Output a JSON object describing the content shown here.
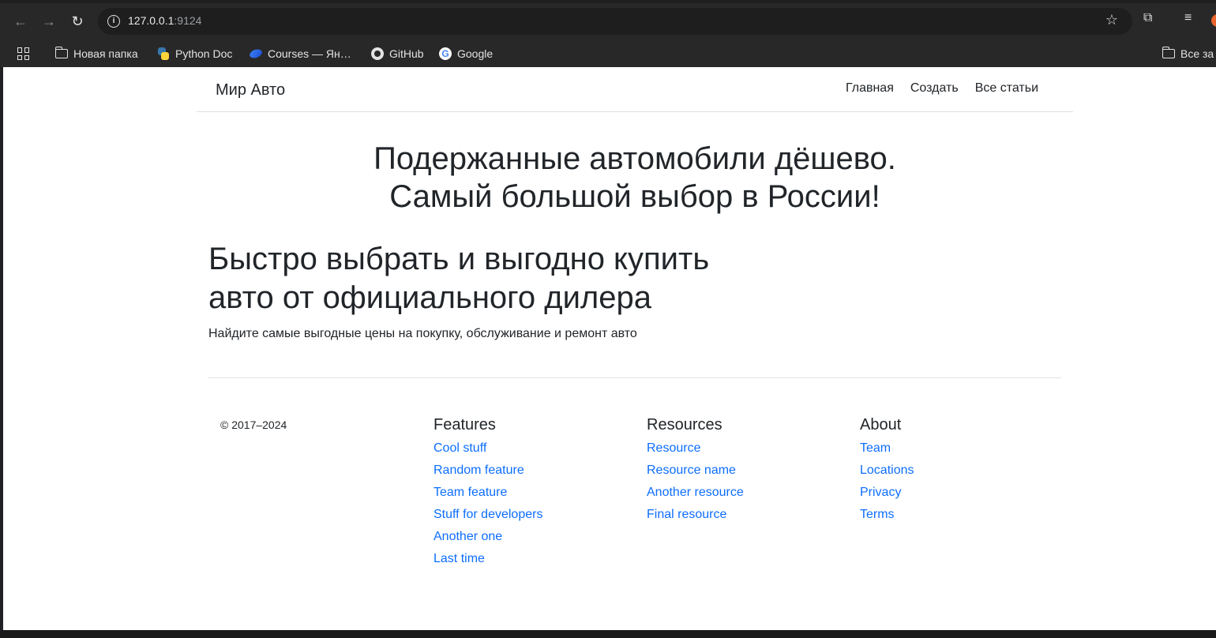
{
  "browser": {
    "url_host": "127.0.0.1",
    "url_port": ":9124",
    "back_icon": "arrow-left-icon",
    "forward_icon": "arrow-right-icon",
    "reload_icon": "reload-icon",
    "bookmarks": [
      {
        "label": "Новая папка",
        "icon": "folder-icon"
      },
      {
        "label": "Python Doc",
        "icon": "python-icon"
      },
      {
        "label": "Courses — Ян…",
        "icon": "courses-icon"
      },
      {
        "label": "GitHub",
        "icon": "github-icon"
      },
      {
        "label": "Google",
        "icon": "google-icon"
      }
    ],
    "other_bookmarks": "Все за"
  },
  "site": {
    "brand": "Мир Авто",
    "nav": [
      "Главная",
      "Создать",
      "Все статьи"
    ]
  },
  "hero": {
    "line1": "Подержанные автомобили дёшево.",
    "line2": "Самый большой выбор в России!"
  },
  "lead": {
    "line1": "Быстро выбрать и выгодно купить",
    "line2": "авто от официального дилера",
    "text": "Найдите самые выгодные цены на покупку, обслуживание и ремонт авто"
  },
  "footer": {
    "copyright": "© 2017–2024",
    "columns": [
      {
        "title": "Features",
        "links": [
          "Cool stuff",
          "Random feature",
          "Team feature",
          "Stuff for developers",
          "Another one",
          "Last time"
        ]
      },
      {
        "title": "Resources",
        "links": [
          "Resource",
          "Resource name",
          "Another resource",
          "Final resource"
        ]
      },
      {
        "title": "About",
        "links": [
          "Team",
          "Locations",
          "Privacy",
          "Terms"
        ]
      }
    ]
  },
  "colors": {
    "link": "#0d6efd",
    "text": "#212529",
    "chrome_bg": "#282828"
  }
}
